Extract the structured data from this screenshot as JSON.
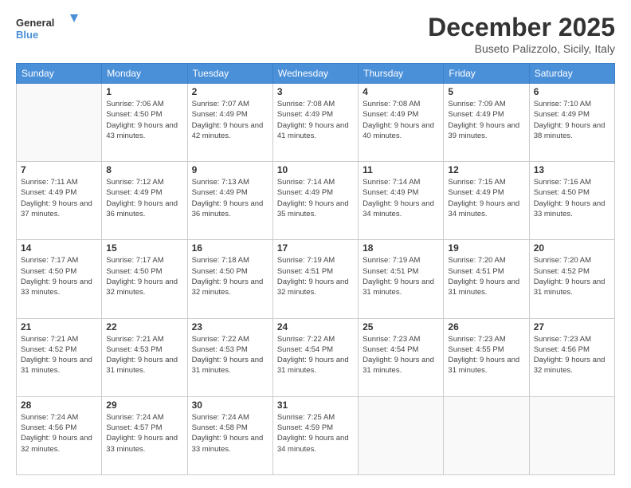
{
  "logo": {
    "line1": "General",
    "line2": "Blue"
  },
  "title": "December 2025",
  "location": "Buseto Palizzolo, Sicily, Italy",
  "days_header": [
    "Sunday",
    "Monday",
    "Tuesday",
    "Wednesday",
    "Thursday",
    "Friday",
    "Saturday"
  ],
  "weeks": [
    [
      {
        "day": "",
        "sunrise": "",
        "sunset": "",
        "daylight": ""
      },
      {
        "day": "1",
        "sunrise": "Sunrise: 7:06 AM",
        "sunset": "Sunset: 4:50 PM",
        "daylight": "Daylight: 9 hours and 43 minutes."
      },
      {
        "day": "2",
        "sunrise": "Sunrise: 7:07 AM",
        "sunset": "Sunset: 4:49 PM",
        "daylight": "Daylight: 9 hours and 42 minutes."
      },
      {
        "day": "3",
        "sunrise": "Sunrise: 7:08 AM",
        "sunset": "Sunset: 4:49 PM",
        "daylight": "Daylight: 9 hours and 41 minutes."
      },
      {
        "day": "4",
        "sunrise": "Sunrise: 7:08 AM",
        "sunset": "Sunset: 4:49 PM",
        "daylight": "Daylight: 9 hours and 40 minutes."
      },
      {
        "day": "5",
        "sunrise": "Sunrise: 7:09 AM",
        "sunset": "Sunset: 4:49 PM",
        "daylight": "Daylight: 9 hours and 39 minutes."
      },
      {
        "day": "6",
        "sunrise": "Sunrise: 7:10 AM",
        "sunset": "Sunset: 4:49 PM",
        "daylight": "Daylight: 9 hours and 38 minutes."
      }
    ],
    [
      {
        "day": "7",
        "sunrise": "Sunrise: 7:11 AM",
        "sunset": "Sunset: 4:49 PM",
        "daylight": "Daylight: 9 hours and 37 minutes."
      },
      {
        "day": "8",
        "sunrise": "Sunrise: 7:12 AM",
        "sunset": "Sunset: 4:49 PM",
        "daylight": "Daylight: 9 hours and 36 minutes."
      },
      {
        "day": "9",
        "sunrise": "Sunrise: 7:13 AM",
        "sunset": "Sunset: 4:49 PM",
        "daylight": "Daylight: 9 hours and 36 minutes."
      },
      {
        "day": "10",
        "sunrise": "Sunrise: 7:14 AM",
        "sunset": "Sunset: 4:49 PM",
        "daylight": "Daylight: 9 hours and 35 minutes."
      },
      {
        "day": "11",
        "sunrise": "Sunrise: 7:14 AM",
        "sunset": "Sunset: 4:49 PM",
        "daylight": "Daylight: 9 hours and 34 minutes."
      },
      {
        "day": "12",
        "sunrise": "Sunrise: 7:15 AM",
        "sunset": "Sunset: 4:49 PM",
        "daylight": "Daylight: 9 hours and 34 minutes."
      },
      {
        "day": "13",
        "sunrise": "Sunrise: 7:16 AM",
        "sunset": "Sunset: 4:50 PM",
        "daylight": "Daylight: 9 hours and 33 minutes."
      }
    ],
    [
      {
        "day": "14",
        "sunrise": "Sunrise: 7:17 AM",
        "sunset": "Sunset: 4:50 PM",
        "daylight": "Daylight: 9 hours and 33 minutes."
      },
      {
        "day": "15",
        "sunrise": "Sunrise: 7:17 AM",
        "sunset": "Sunset: 4:50 PM",
        "daylight": "Daylight: 9 hours and 32 minutes."
      },
      {
        "day": "16",
        "sunrise": "Sunrise: 7:18 AM",
        "sunset": "Sunset: 4:50 PM",
        "daylight": "Daylight: 9 hours and 32 minutes."
      },
      {
        "day": "17",
        "sunrise": "Sunrise: 7:19 AM",
        "sunset": "Sunset: 4:51 PM",
        "daylight": "Daylight: 9 hours and 32 minutes."
      },
      {
        "day": "18",
        "sunrise": "Sunrise: 7:19 AM",
        "sunset": "Sunset: 4:51 PM",
        "daylight": "Daylight: 9 hours and 31 minutes."
      },
      {
        "day": "19",
        "sunrise": "Sunrise: 7:20 AM",
        "sunset": "Sunset: 4:51 PM",
        "daylight": "Daylight: 9 hours and 31 minutes."
      },
      {
        "day": "20",
        "sunrise": "Sunrise: 7:20 AM",
        "sunset": "Sunset: 4:52 PM",
        "daylight": "Daylight: 9 hours and 31 minutes."
      }
    ],
    [
      {
        "day": "21",
        "sunrise": "Sunrise: 7:21 AM",
        "sunset": "Sunset: 4:52 PM",
        "daylight": "Daylight: 9 hours and 31 minutes."
      },
      {
        "day": "22",
        "sunrise": "Sunrise: 7:21 AM",
        "sunset": "Sunset: 4:53 PM",
        "daylight": "Daylight: 9 hours and 31 minutes."
      },
      {
        "day": "23",
        "sunrise": "Sunrise: 7:22 AM",
        "sunset": "Sunset: 4:53 PM",
        "daylight": "Daylight: 9 hours and 31 minutes."
      },
      {
        "day": "24",
        "sunrise": "Sunrise: 7:22 AM",
        "sunset": "Sunset: 4:54 PM",
        "daylight": "Daylight: 9 hours and 31 minutes."
      },
      {
        "day": "25",
        "sunrise": "Sunrise: 7:23 AM",
        "sunset": "Sunset: 4:54 PM",
        "daylight": "Daylight: 9 hours and 31 minutes."
      },
      {
        "day": "26",
        "sunrise": "Sunrise: 7:23 AM",
        "sunset": "Sunset: 4:55 PM",
        "daylight": "Daylight: 9 hours and 31 minutes."
      },
      {
        "day": "27",
        "sunrise": "Sunrise: 7:23 AM",
        "sunset": "Sunset: 4:56 PM",
        "daylight": "Daylight: 9 hours and 32 minutes."
      }
    ],
    [
      {
        "day": "28",
        "sunrise": "Sunrise: 7:24 AM",
        "sunset": "Sunset: 4:56 PM",
        "daylight": "Daylight: 9 hours and 32 minutes."
      },
      {
        "day": "29",
        "sunrise": "Sunrise: 7:24 AM",
        "sunset": "Sunset: 4:57 PM",
        "daylight": "Daylight: 9 hours and 33 minutes."
      },
      {
        "day": "30",
        "sunrise": "Sunrise: 7:24 AM",
        "sunset": "Sunset: 4:58 PM",
        "daylight": "Daylight: 9 hours and 33 minutes."
      },
      {
        "day": "31",
        "sunrise": "Sunrise: 7:25 AM",
        "sunset": "Sunset: 4:59 PM",
        "daylight": "Daylight: 9 hours and 34 minutes."
      },
      {
        "day": "",
        "sunrise": "",
        "sunset": "",
        "daylight": ""
      },
      {
        "day": "",
        "sunrise": "",
        "sunset": "",
        "daylight": ""
      },
      {
        "day": "",
        "sunrise": "",
        "sunset": "",
        "daylight": ""
      }
    ]
  ]
}
